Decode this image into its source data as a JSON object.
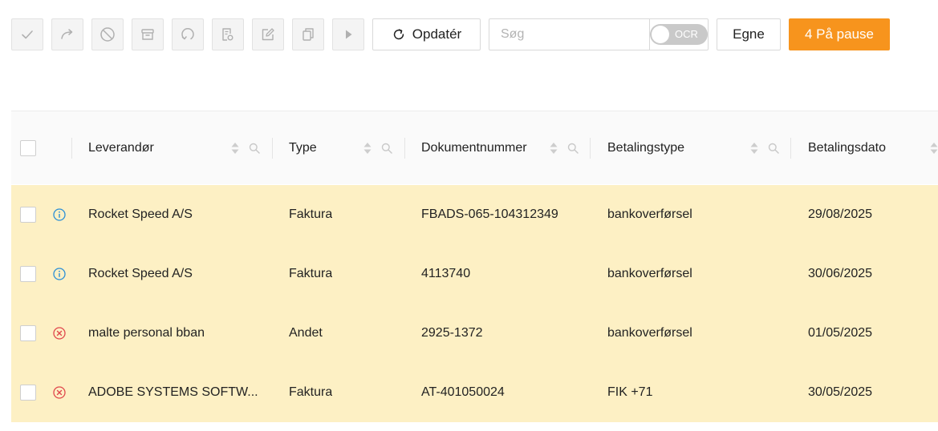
{
  "toolbar": {
    "icons": [
      {
        "name": "approve-check-icon"
      },
      {
        "name": "forward-arrow-icon"
      },
      {
        "name": "block-circle-icon"
      },
      {
        "name": "archive-box-icon"
      },
      {
        "name": "reload-circle-icon"
      },
      {
        "name": "document-search-icon"
      },
      {
        "name": "edit-pencil-icon"
      },
      {
        "name": "copy-document-icon"
      },
      {
        "name": "play-icon"
      }
    ],
    "refresh_label": "Opdatér",
    "search_placeholder": "Søg",
    "search_value": "",
    "ocr_label": "OCR",
    "ocr_enabled": false,
    "own_label": "Egne",
    "pause_label": "4 På pause",
    "pause_color": "#f7941d"
  },
  "table": {
    "columns": [
      {
        "key": "supplier",
        "label": "Leverandør"
      },
      {
        "key": "type",
        "label": "Type"
      },
      {
        "key": "doc_number",
        "label": "Dokumentnummer"
      },
      {
        "key": "payment_type",
        "label": "Betalingstype"
      },
      {
        "key": "payment_date",
        "label": "Betalingsdato"
      }
    ],
    "row_color": "#fdf0c4",
    "rows": [
      {
        "status": "info",
        "supplier": "Rocket Speed A/S",
        "type": "Faktura",
        "doc_number": "FBADS-065-104312349",
        "payment_type": "bankoverførsel",
        "payment_date": "29/08/2025"
      },
      {
        "status": "info",
        "supplier": "Rocket Speed A/S",
        "type": "Faktura",
        "doc_number": "4113740",
        "payment_type": "bankoverførsel",
        "payment_date": "30/06/2025"
      },
      {
        "status": "error",
        "supplier": "malte personal bban",
        "type": "Andet",
        "doc_number": "2925-1372",
        "payment_type": "bankoverførsel",
        "payment_date": "01/05/2025"
      },
      {
        "status": "error",
        "supplier": "ADOBE SYSTEMS SOFTW...",
        "type": "Faktura",
        "doc_number": "AT-401050024",
        "payment_type": "FIK +71",
        "payment_date": "30/05/2025"
      }
    ]
  },
  "colors": {
    "info": "#2b8fd6",
    "error": "#e0474c",
    "accent": "#f7941d"
  }
}
